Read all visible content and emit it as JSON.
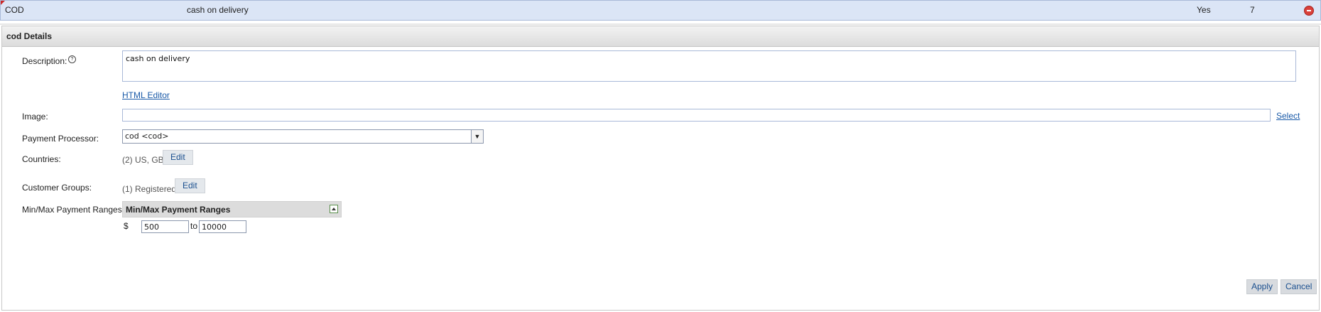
{
  "list_row": {
    "code": "COD",
    "description": "cash on delivery",
    "enabled": "Yes",
    "sort_order": "7"
  },
  "details": {
    "title": "cod Details",
    "description_label": "Description:",
    "description_value": "cash on delivery",
    "html_editor_link": "HTML Editor",
    "image_label": "Image:",
    "image_value": "",
    "select_link": "Select",
    "payment_processor_label": "Payment Processor:",
    "payment_processor_value": "cod <cod>",
    "countries_label": "Countries:",
    "countries_value": "(2) US, GB",
    "countries_edit": "Edit",
    "customer_groups_label": "Customer Groups:",
    "customer_groups_value": "(1) Registered",
    "customer_groups_edit": "Edit",
    "ranges_label": "Min/Max Payment Ranges:",
    "ranges_title": "Min/Max Payment Ranges",
    "currency_symbol": "$",
    "min_value": "500",
    "to_label": "to",
    "max_value": "10000"
  },
  "actions": {
    "apply": "Apply",
    "cancel": "Cancel"
  },
  "icons": {
    "remove": "remove-circle-icon",
    "help": "help-icon",
    "dropdown": "chevron-down-icon",
    "collapse": "collapse-icon"
  }
}
